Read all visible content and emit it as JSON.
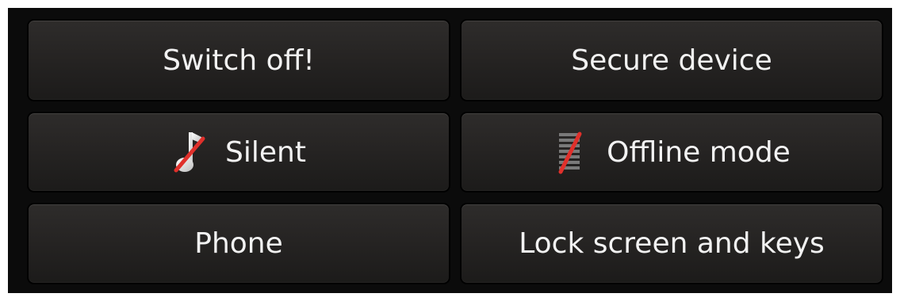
{
  "menu": {
    "switch_off_label": "Switch off!",
    "secure_device_label": "Secure device",
    "silent_label": "Silent",
    "offline_mode_label": "Offline mode",
    "phone_label": "Phone",
    "lock_label": "Lock screen and keys"
  },
  "icons": {
    "silent": "silent-profile-icon",
    "offline": "offline-mode-icon"
  },
  "colors": {
    "background": "#0b0b0b",
    "button_face": "#262423",
    "text": "#f2f2f2",
    "strike_red": "#e0302b"
  }
}
